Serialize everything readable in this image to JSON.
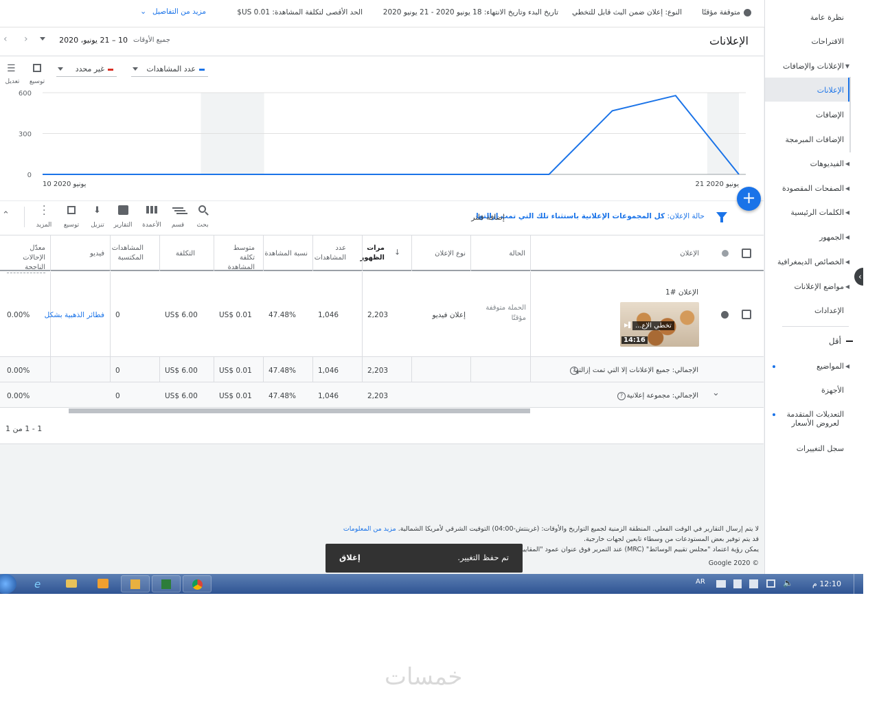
{
  "sidebar": {
    "items": [
      {
        "label": "نظرة عامة",
        "caret": false,
        "dot": false,
        "sel": false
      },
      {
        "label": "الاقتراحات",
        "caret": false,
        "dot": false,
        "sel": false
      },
      {
        "label": "الإعلانات والإضافات",
        "caret": true,
        "dot": false,
        "sel": false
      },
      {
        "label": "الإعلانات",
        "caret": false,
        "dot": false,
        "sel": true
      },
      {
        "label": "الإضافات",
        "caret": false,
        "dot": false,
        "sel": false
      },
      {
        "label": "الإضافات المبرمجة",
        "caret": false,
        "dot": false,
        "sel": false
      },
      {
        "label": "الفيديوهات",
        "caret": true,
        "dot": false,
        "sel": false
      },
      {
        "label": "الصفحات المقصودة",
        "caret": true,
        "dot": false,
        "sel": false
      },
      {
        "label": "الكلمات الرئيسية",
        "caret": true,
        "dot": false,
        "sel": false
      },
      {
        "label": "الجمهور",
        "caret": true,
        "dot": false,
        "sel": false
      },
      {
        "label": "الخصائص الديمغرافية",
        "caret": true,
        "dot": false,
        "sel": false
      },
      {
        "label": "مواضع الإعلانات",
        "caret": true,
        "dot": false,
        "sel": false
      },
      {
        "label": "الإعدادات",
        "caret": false,
        "dot": false,
        "sel": false
      }
    ],
    "less_label": "أقل",
    "more_items": [
      {
        "label": "المواضيع",
        "caret": true,
        "dot": true
      },
      {
        "label": "الأجهزة",
        "caret": false,
        "dot": false
      },
      {
        "label": "التعديلات المتقدمة",
        "label2": "لعروض الأسعار",
        "caret": false,
        "dot": true
      },
      {
        "label": "سجل التغييرات",
        "caret": false,
        "dot": false
      }
    ]
  },
  "info": {
    "status": "متوقفة مؤقتًا",
    "type": "النوع: إعلان ضمن البث قابل للتخطي",
    "dates": "تاريخ البدء وتاريخ الانتهاء: 18 يونيو 2020 - 21 يونيو 2020",
    "maxcpv": "الحد الأقصى لتكلفة المشاهدة: 0.01 US$",
    "more": "مزيد من التفاصيل"
  },
  "header": {
    "title": "الإعلانات",
    "range_label": "جميع الأوقات",
    "range_value": "10 – 21 يونيو، 2020"
  },
  "chart_controls": {
    "metric1": "عدد المشاهدات",
    "metric2": "غير محدد",
    "adjust": "تعديل",
    "expand": "توسيع"
  },
  "chart_data": {
    "type": "line",
    "x": [
      "10 يونيو 2020",
      "11",
      "12",
      "13",
      "14",
      "15",
      "16",
      "17",
      "18",
      "19",
      "20",
      "21 يونيو 2020"
    ],
    "series": [
      {
        "values": [
          0,
          0,
          0,
          0,
          0,
          0,
          0,
          0,
          0,
          467,
          579,
          0
        ]
      }
    ],
    "yticks": [
      0,
      300,
      600
    ],
    "ylim": [
      0,
      600
    ],
    "xtick_labels": [
      "10 يونيو 2020",
      "21 يونيو 2020"
    ],
    "shaded_days": [
      3,
      11
    ],
    "color": "#1a73e8"
  },
  "filter": {
    "text_prefix": "حالة الإعلان: ",
    "text_bold": "كل المجموعات الإعلانية باستثناء تلك التي تمت إزالتها",
    "add": "إضافة فلتر"
  },
  "toolbar": {
    "search": "بحث",
    "segment": "قسم",
    "columns": "الأعمدة",
    "reports": "التقارير",
    "download": "تنزيل",
    "expand": "توسيع",
    "more": "المزيد"
  },
  "table": {
    "headers": {
      "ad": "الإعلان",
      "status": "الحالة",
      "ad_type": "نوع الإعلان",
      "impr": "مرات الظهور",
      "views": "عدد المشاهدات",
      "view_rate": "نسبة المشاهدة",
      "avg_cpv": "متوسط تكلفة المشاهدة",
      "cost": "التكلفة",
      "earned": "المشاهدات المكتسبة",
      "video": "فيديو",
      "conv_rate": "معدّل الإحالات الناجحة"
    },
    "row": {
      "ad_name": "الإعلان #1",
      "thumb_title": "تخطي الإع...",
      "thumb_duration": "14:16",
      "status": "الحملة متوقفة مؤقتًا",
      "ad_type": "إعلان فيديو",
      "impr": "2,203",
      "views": "1,046",
      "view_rate": "47.48%",
      "avg_cpv": "US$ 0.01",
      "cost": "US$ 6.00",
      "earned": "0",
      "video": "فطائر الذهبية بشكل",
      "conv_rate": "0.00%"
    },
    "total1": {
      "label": "الإجمالي: جميع الإعلانات إلا التي تمت إزالتها",
      "impr": "2,203",
      "views": "1,046",
      "view_rate": "47.48%",
      "avg_cpv": "US$ 0.01",
      "cost": "US$ 6.00",
      "earned": "0",
      "conv_rate": "0.00%"
    },
    "total2": {
      "label": "الإجمالي: مجموعة إعلانية",
      "impr": "2,203",
      "views": "1,046",
      "view_rate": "47.48%",
      "avg_cpv": "US$ 0.01",
      "cost": "US$ 6.00",
      "earned": "0",
      "conv_rate": "0.00%"
    },
    "pagination": "1 - 1 من 1"
  },
  "footer": {
    "line1": "لا يتم إرسال التقارير في الوقت الفعلي. المنطقة الزمنية لجميع التواريخ والأوقات: (غرينتش-04:00) التوقيت الشرقي لأمريكا الشمالية.",
    "line1_link": "مزيد من المعلومات",
    "line2": "قد يتم توفير بعض المستودعات من وسطاء تابعين لجهات خارجية.",
    "line3": "يمكن رؤية اعتماد \"مجلس تقييم الوسائط\" (MRC) عند التمرير فوق عنوان عمود \"المقاييس",
    "copyright": "© Google 2020"
  },
  "toast": {
    "message": "تم حفظ التغيير.",
    "close": "إغلاق"
  },
  "taskbar": {
    "lang": "AR",
    "time": "12:10 م"
  },
  "watermark": "خمسات"
}
